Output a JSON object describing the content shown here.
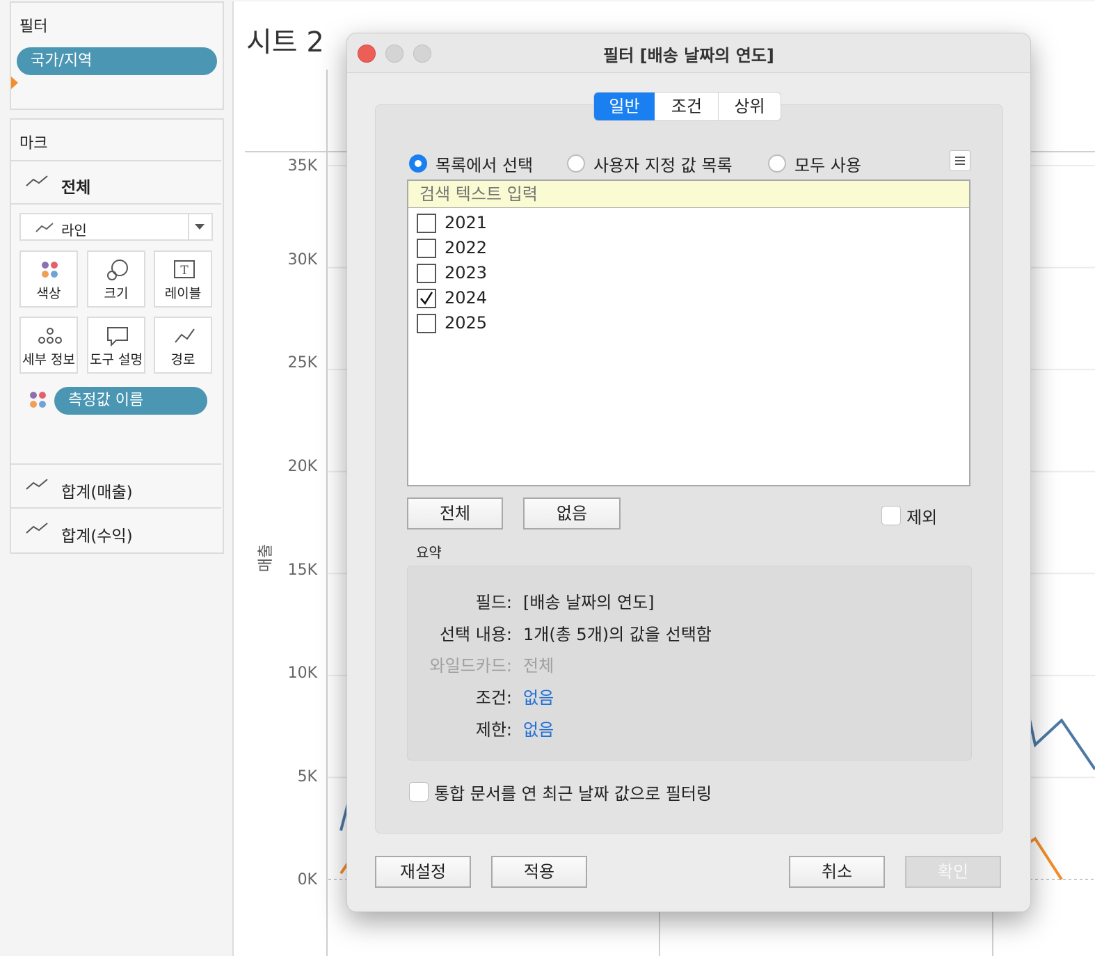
{
  "filters_panel": {
    "title": "필터",
    "pills": [
      "국가/지역"
    ]
  },
  "marks_panel": {
    "title": "마크",
    "all_label": "전체",
    "mark_type": "라인",
    "cards": {
      "color": "색상",
      "size": "크기",
      "label": "레이블",
      "detail": "세부 정보",
      "tooltip": "도구 설명",
      "path": "경로"
    },
    "color_pill": "측정값 이름",
    "measures": [
      "합계(매출)",
      "합계(수익)"
    ]
  },
  "sheet": {
    "title": "시트 2",
    "y_axis_label": "매출",
    "y_ticks": [
      "35K",
      "30K",
      "25K",
      "20K",
      "15K",
      "10K",
      "5K",
      "0K"
    ]
  },
  "chart_data": {
    "type": "line",
    "ylabel": "매출",
    "ylim": [
      0,
      35000
    ],
    "series": [
      {
        "color": "#4e79a7",
        "values": [
          9400,
          6600,
          7800,
          5400
        ]
      },
      {
        "color": "#f28e2b",
        "values": [
          1600,
          2000,
          0
        ]
      }
    ]
  },
  "dialog": {
    "title": "필터 [배송 날짜의 연도]",
    "tabs": [
      "일반",
      "조건",
      "상위"
    ],
    "active_tab": "일반",
    "radios": [
      "목록에서 선택",
      "사용자 지정 값 목록",
      "모두 사용"
    ],
    "selected_radio": "목록에서 선택",
    "search_placeholder": "검색 텍스트 입력",
    "items": [
      {
        "label": "2021",
        "checked": false
      },
      {
        "label": "2022",
        "checked": false
      },
      {
        "label": "2023",
        "checked": false
      },
      {
        "label": "2024",
        "checked": true
      },
      {
        "label": "2025",
        "checked": false
      }
    ],
    "all_button": "전체",
    "none_button": "없음",
    "exclude_label": "제외",
    "summary_title": "요약",
    "summary": {
      "field_label": "필드:",
      "field_value": "[배송 날짜의 연도]",
      "selection_label": "선택 내용:",
      "selection_value": "1개(총 5개)의 값을 선택함",
      "wildcard_label": "와일드카드:",
      "wildcard_value": "전체",
      "condition_label": "조건:",
      "condition_value": "없음",
      "limit_label": "제한:",
      "limit_value": "없음"
    },
    "latest_date_label": "통합 문서를 연 최근 날짜 값으로 필터링",
    "reset_button": "재설정",
    "apply_button": "적용",
    "cancel_button": "취소",
    "ok_button": "확인"
  },
  "colors": {
    "pill": "#4a96b3",
    "accent_blue": "#1a7ff0",
    "link_blue": "#1f6fd6",
    "search_bg": "#fbfbd3"
  }
}
